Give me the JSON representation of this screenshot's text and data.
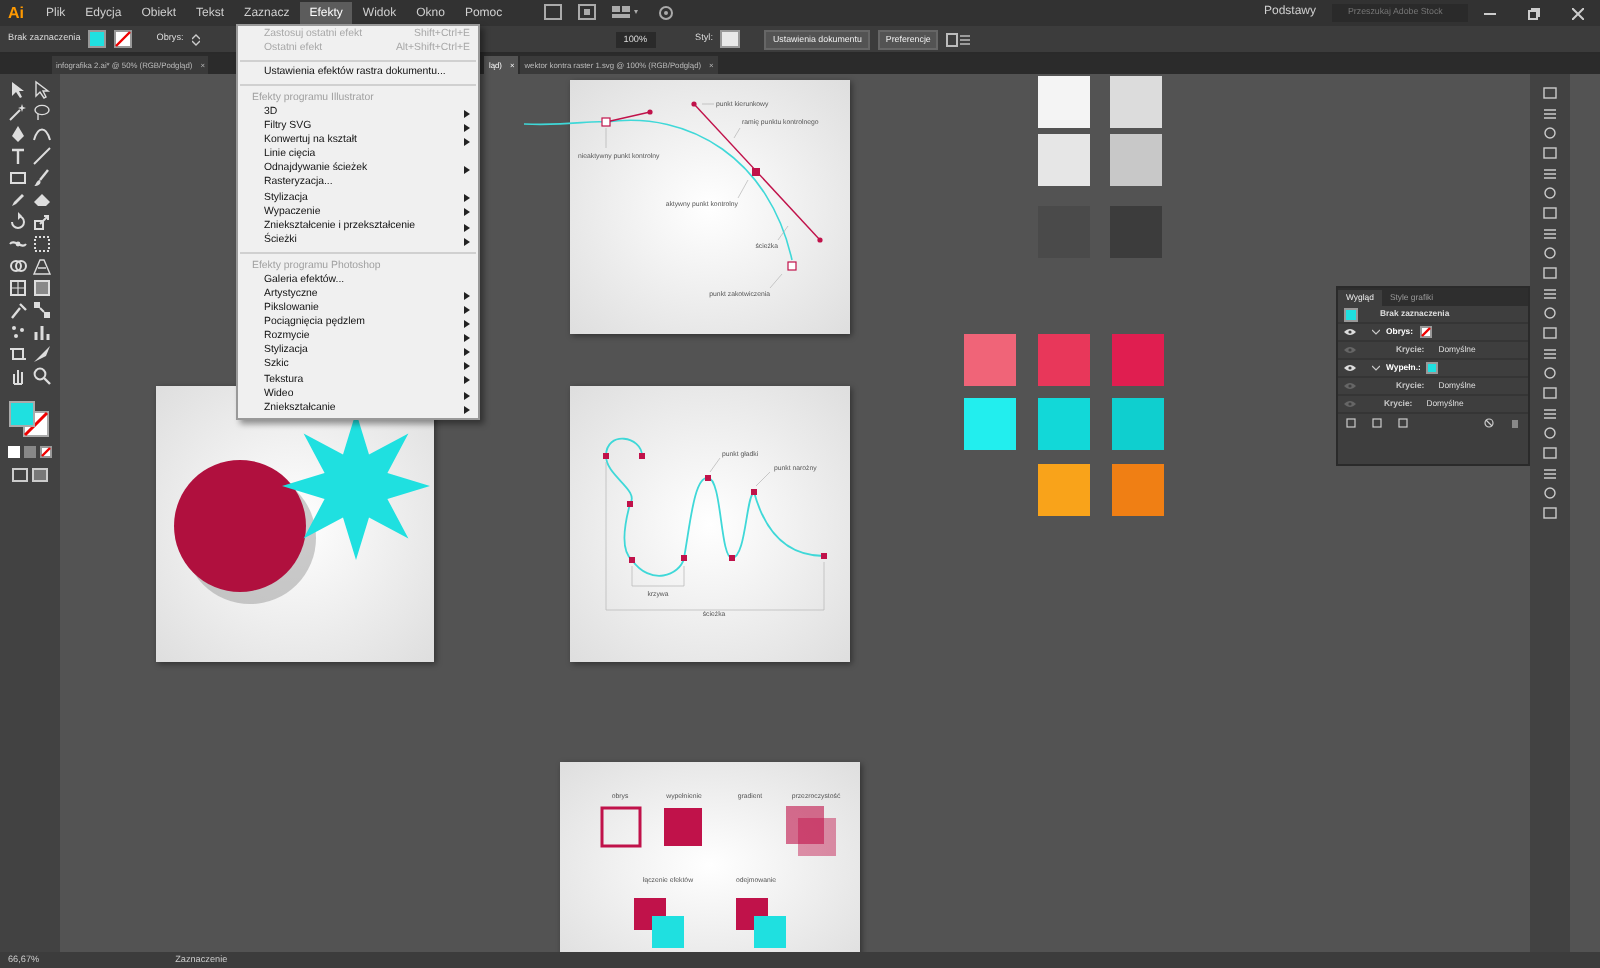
{
  "menubar": {
    "logo": "Ai",
    "menus": [
      {
        "label": "Plik",
        "selected": false
      },
      {
        "label": "Edycja",
        "selected": false
      },
      {
        "label": "Obiekt",
        "selected": false
      },
      {
        "label": "Tekst",
        "selected": false
      },
      {
        "label": "Zaznacz",
        "selected": false
      },
      {
        "label": "Efekty",
        "selected": true
      },
      {
        "label": "Widok",
        "selected": false
      },
      {
        "label": "Okno",
        "selected": false
      },
      {
        "label": "Pomoc",
        "selected": false
      }
    ],
    "workspace": "Podstawy",
    "search": {
      "placeholder": "Przeszukaj Adobe Stock"
    }
  },
  "controlbar": {
    "selection": "Brak zaznaczenia",
    "fill_swatch": {
      "color": "#1fe0e0"
    },
    "stroke_label": "Obrys:",
    "zoom": "100%",
    "style_label": "Styl:",
    "buttons": [
      "Ustawienia dokumentu",
      "Preferencje"
    ]
  },
  "tabs": [
    {
      "label": "infografika 2.ai* @ 50% (RGB/Podgląd)",
      "close": "×",
      "selected": false
    },
    {
      "label": "ląd)",
      "close": "×",
      "selected": true
    },
    {
      "label": "wektor kontra raster 1.svg @ 100% (RGB/Podgląd)",
      "close": "×",
      "selected": false
    }
  ],
  "effects_menu": {
    "sections": [
      {
        "items": [
          {
            "label": "Zastosuj ostatni efekt",
            "shortcut": "Shift+Ctrl+E",
            "disabled": true,
            "submenu": false
          },
          {
            "label": "Ostatni efekt",
            "shortcut": "Alt+Shift+Ctrl+E",
            "disabled": true,
            "submenu": false
          }
        ]
      },
      {
        "items": [
          {
            "label": "Ustawienia efektów rastra dokumentu...",
            "disabled": false,
            "submenu": false
          }
        ]
      },
      {
        "header": "Efekty programu Illustrator",
        "items": [
          {
            "label": "3D",
            "disabled": false,
            "submenu": true
          },
          {
            "label": "Filtry SVG",
            "disabled": false,
            "submenu": true
          },
          {
            "label": "Konwertuj na kształt",
            "disabled": false,
            "submenu": true
          },
          {
            "label": "Linie cięcia",
            "disabled": false,
            "submenu": false
          },
          {
            "label": "Odnajdywanie ścieżek",
            "disabled": false,
            "submenu": true
          },
          {
            "label": "Rasteryzacja...",
            "disabled": false,
            "submenu": false
          },
          {
            "label": "Stylizacja",
            "disabled": false,
            "submenu": true
          },
          {
            "label": "Wypaczenie",
            "disabled": false,
            "submenu": true
          },
          {
            "label": "Zniekształcenie i przekształcenie",
            "disabled": false,
            "submenu": true
          },
          {
            "label": "Ścieżki",
            "disabled": false,
            "submenu": true
          }
        ]
      },
      {
        "header": "Efekty programu Photoshop",
        "items": [
          {
            "label": "Galeria efektów...",
            "disabled": false,
            "submenu": false
          },
          {
            "label": "Artystyczne",
            "disabled": false,
            "submenu": true
          },
          {
            "label": "Pikslowanie",
            "disabled": false,
            "submenu": true
          },
          {
            "label": "Pociągnięcia pędzlem",
            "disabled": false,
            "submenu": true
          },
          {
            "label": "Rozmycie",
            "disabled": false,
            "submenu": true
          },
          {
            "label": "Stylizacja",
            "disabled": false,
            "submenu": true
          },
          {
            "label": "Szkic",
            "disabled": false,
            "submenu": true
          },
          {
            "label": "Tekstura",
            "disabled": false,
            "submenu": true
          },
          {
            "label": "Wideo",
            "disabled": false,
            "submenu": true
          },
          {
            "label": "Zniekształcanie",
            "disabled": false,
            "submenu": true
          }
        ]
      }
    ]
  },
  "artboards": {
    "control_points": [
      "punkt kierunkowy",
      "ramię punktu kontrolnego",
      "nieaktywny punkt kontrolny",
      "aktywny punkt kontrolny",
      "ścieżka",
      "punkt zakotwiczenia"
    ],
    "path_types": [
      "punkt gładki",
      "punkt narożny",
      "krzywa",
      "ścieżka"
    ],
    "appearance": [
      "obrys",
      "wypełnienie",
      "gradient",
      "przezroczystość",
      "łączenie efektów",
      "odejmowanie"
    ]
  },
  "swatches": [
    {
      "color": "#f4f4f4"
    },
    {
      "color": "#dcdcdc"
    },
    {
      "color": "#e6e6e6"
    },
    {
      "color": "#c8c8c8"
    },
    {
      "color": "#4a4a4a"
    },
    {
      "color": "#3c3c3c"
    },
    {
      "color": "#f06478"
    },
    {
      "color": "#e8375a"
    },
    {
      "color": "#e01e50"
    },
    {
      "color": "#22eeee"
    },
    {
      "color": "#12d8d8"
    },
    {
      "color": "#0fcfcf"
    },
    {
      "color": "#f9a31a"
    },
    {
      "color": "#f07f14"
    }
  ],
  "appearance_panel": {
    "tabs": [
      {
        "label": "Wygląd",
        "selected": true
      },
      {
        "label": "Style grafiki",
        "selected": false
      }
    ],
    "title": "Brak zaznaczenia",
    "rows": [
      {
        "kind": "stroke",
        "label": "Obrys:",
        "visible": true,
        "expanded": true,
        "children": [
          {
            "kind": "opacity",
            "label": "Krycie:",
            "value": "Domyślne",
            "visible": false
          }
        ]
      },
      {
        "kind": "fill",
        "label": "Wypełn.:",
        "visible": true,
        "expanded": true,
        "children": [
          {
            "kind": "opacity",
            "label": "Krycie:",
            "value": "Domyślne",
            "visible": false
          }
        ]
      },
      {
        "kind": "opacity",
        "label": "Krycie:",
        "value": "Domyślne",
        "visible": false
      }
    ]
  },
  "status_bar": {
    "zoom": "66,67%",
    "tool": "Zaznaczenie"
  }
}
